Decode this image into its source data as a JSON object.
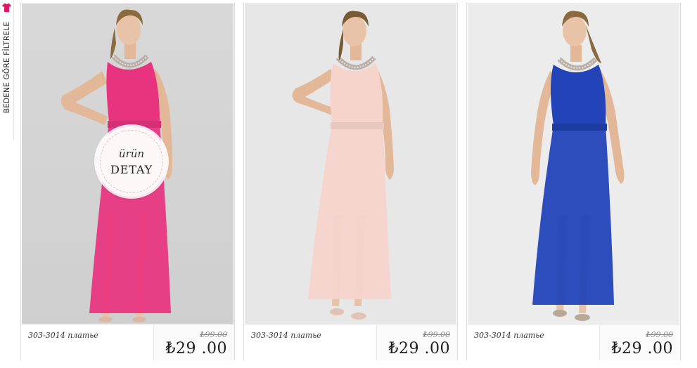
{
  "filter": {
    "label": "BEDENE GÖRE FİLTRELE",
    "icon": "tshirt-icon",
    "icon_color": "#e2156b"
  },
  "badge": {
    "top": "ürün",
    "bottom": "DETAY"
  },
  "products": [
    {
      "name": "303-3014 платье",
      "old_price": "₺99.00",
      "price": "₺29 .00",
      "dress_color": "#e8347f"
    },
    {
      "name": "303-3014 платье",
      "old_price": "₺99.00",
      "price": "₺29 .00",
      "dress_color": "#f6d4cc"
    },
    {
      "name": "303-3014 платье",
      "old_price": "₺99.00",
      "price": "₺29 .00",
      "dress_color": "#2244b8"
    }
  ]
}
